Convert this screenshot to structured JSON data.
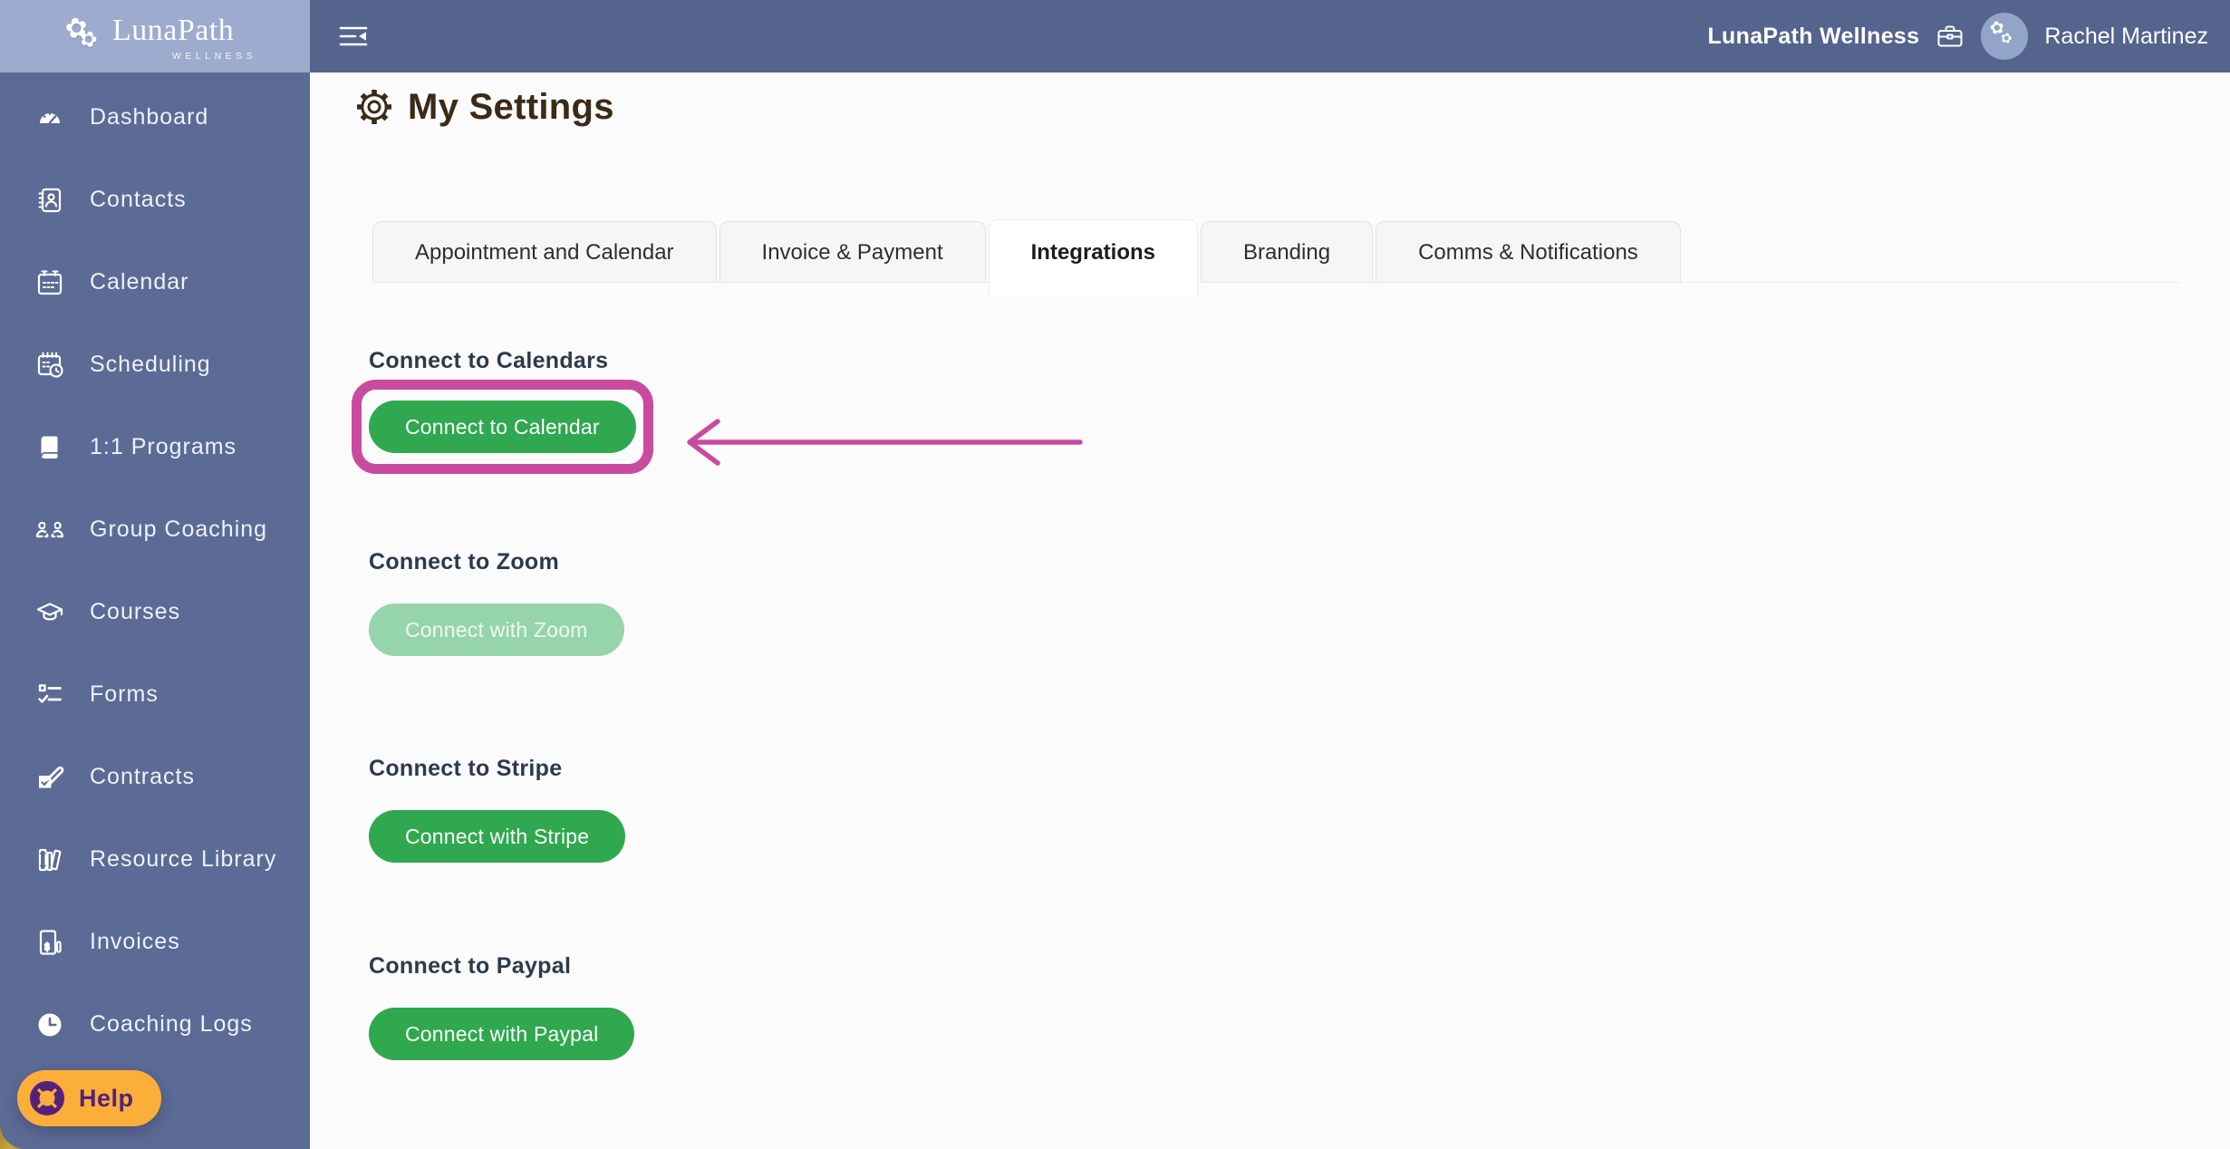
{
  "brand": {
    "name": "LunaPath",
    "tagline": "WELLNESS"
  },
  "header": {
    "workspace": "LunaPath Wellness",
    "user_name": "Rachel Martinez"
  },
  "sidebar": {
    "items": [
      {
        "label": "Dashboard"
      },
      {
        "label": "Contacts"
      },
      {
        "label": "Calendar"
      },
      {
        "label": "Scheduling"
      },
      {
        "label": "1:1 Programs"
      },
      {
        "label": "Group Coaching"
      },
      {
        "label": "Courses"
      },
      {
        "label": "Forms"
      },
      {
        "label": "Contracts"
      },
      {
        "label": "Resource Library"
      },
      {
        "label": "Invoices"
      },
      {
        "label": "Coaching Logs"
      }
    ]
  },
  "page": {
    "title": "My Settings"
  },
  "tabs": [
    {
      "label": "Appointment and Calendar",
      "active": false
    },
    {
      "label": "Invoice & Payment",
      "active": false
    },
    {
      "label": "Integrations",
      "active": true
    },
    {
      "label": "Branding",
      "active": false
    },
    {
      "label": "Comms & Notifications",
      "active": false
    }
  ],
  "sections": [
    {
      "heading": "Connect to Calendars",
      "button_label": "Connect to Calendar",
      "state": "normal",
      "annotated": true
    },
    {
      "heading": "Connect to Zoom",
      "button_label": "Connect with Zoom",
      "state": "disabled",
      "annotated": false
    },
    {
      "heading": "Connect to Stripe",
      "button_label": "Connect with Stripe",
      "state": "normal",
      "annotated": false
    },
    {
      "heading": "Connect to Paypal",
      "button_label": "Connect with Paypal",
      "state": "normal",
      "annotated": false
    }
  ],
  "help": {
    "label": "Help"
  },
  "colors": {
    "sidebar": "#5b6b95",
    "logoband": "#9dabce",
    "header": "#54648d",
    "contentbg": "#fbfbfc",
    "green": "#2fa84f",
    "greenDisabled": "#96d5ab",
    "pink": "#c94b9f",
    "orange": "#fcae3b",
    "purple": "#54217a",
    "brown": "#3b2a17",
    "headingInk": "#2d3a4b",
    "line": "#e8e8e8",
    "tabbg": "#f6f6f6"
  }
}
